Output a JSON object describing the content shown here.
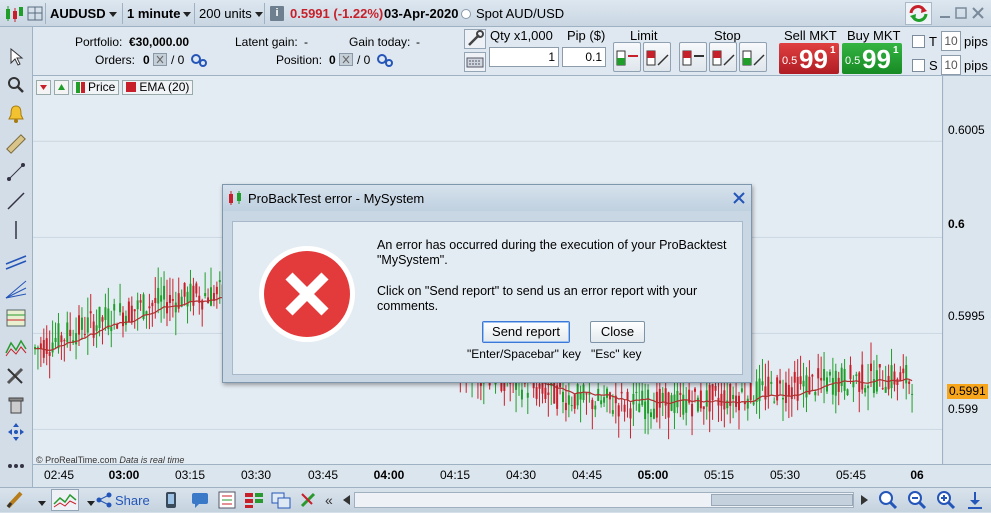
{
  "toolbar": {
    "symbol": "AUDUSD",
    "interval": "1 minute",
    "units": "200 units",
    "price": "0.5991 (-1.22%)",
    "date": "03-Apr-2020",
    "instrument_name": "Spot AUD/USD",
    "info_badge": "i"
  },
  "portfolio": {
    "portfolio_label": "Portfolio:",
    "portfolio_value": "€30,000.00",
    "orders_label": "Orders:",
    "orders_count": "0",
    "orders_slash": "/ 0",
    "latent_label": "Latent gain:",
    "latent_value": "-",
    "today_label": "Gain today:",
    "today_value": "-",
    "position_label": "Position:",
    "position_count": "0",
    "position_slash": "/ 0"
  },
  "order_panel": {
    "qty_label": "Qty x1,000",
    "qty_value": "1",
    "pip_label": "Pip ($)",
    "pip_value": "0.1",
    "limit_label": "Limit",
    "stop_label": "Stop",
    "sell_label": "Sell MKT",
    "buy_label": "Buy MKT",
    "sell_prefix": "0.5",
    "sell_big": "99",
    "sell_sup": "1",
    "buy_prefix": "0.5",
    "buy_big": "99",
    "buy_sup": "1",
    "t_label": "T",
    "t_value": "10",
    "s_label": "S",
    "s_value": "10",
    "pips_label": "pips"
  },
  "legend": {
    "price_label": "Price",
    "ema_label": "EMA (20)"
  },
  "chart_data": {
    "type": "bar",
    "title": "",
    "watermark": "© ProRealTime.com",
    "watermark_note": "Data is real time",
    "y_ticks": [
      "0.6005",
      "0.6",
      "0.5995",
      "0.599"
    ],
    "y_tick_values": [
      0.6005,
      0.6,
      0.5995,
      0.599
    ],
    "current_price_label": "0.5991",
    "x_ticks": [
      "02:45",
      "03:00",
      "03:15",
      "03:30",
      "03:45",
      "04:00",
      "04:15",
      "04:30",
      "04:45",
      "05:00",
      "05:15",
      "05:30",
      "05:45",
      "06"
    ],
    "x_ticks_bold": [
      "03:00",
      "04:00",
      "05:00",
      "06"
    ],
    "ylim": [
      0.59882,
      0.60084
    ],
    "colors": {
      "up": "#1f9e2a",
      "down": "#c8202a",
      "ema": "#b03030"
    }
  },
  "dialog": {
    "title": "ProBackTest error - MySystem",
    "message_1": "An error has occurred during the execution of your ProBacktest \"MySystem\".",
    "message_2": "Click on \"Send report\" to send us an error report with your comments.",
    "send_button": "Send report",
    "close_button": "Close",
    "send_hint": "\"Enter/Spacebar\" key",
    "close_hint": "\"Esc\" key"
  },
  "bottom": {
    "share_label": "Share"
  }
}
